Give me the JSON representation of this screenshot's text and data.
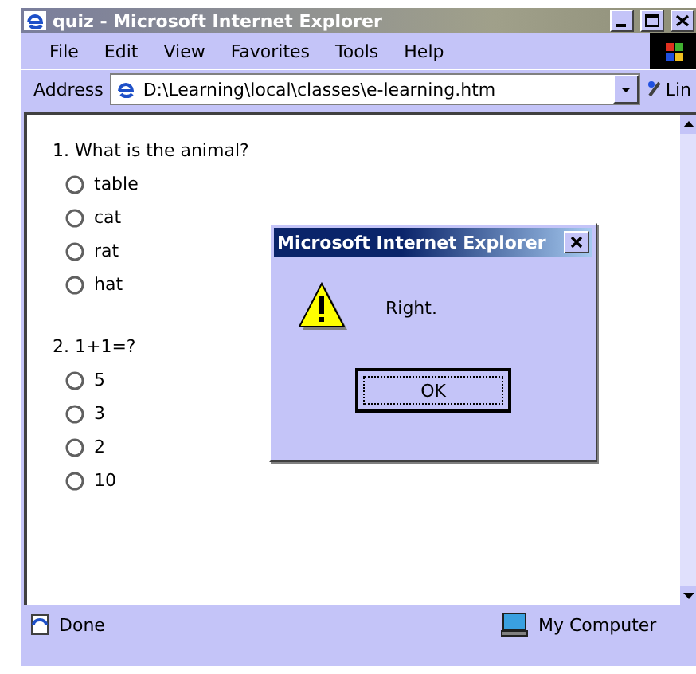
{
  "window": {
    "title": "quiz - Microsoft Internet Explorer"
  },
  "menu": [
    "File",
    "Edit",
    "View",
    "Favorites",
    "Tools",
    "Help"
  ],
  "address_bar": {
    "label": "Address",
    "value": "D:\\Learning\\local\\classes\\e-learning.htm",
    "links_label": "Lin"
  },
  "questions": [
    {
      "text": "1. What is the animal?",
      "options": [
        {
          "label": "table",
          "selected": false
        },
        {
          "label": "cat",
          "selected": false
        },
        {
          "label": "rat",
          "selected": false
        },
        {
          "label": "hat",
          "selected": false
        }
      ]
    },
    {
      "text": "2. 1+1=?",
      "options": [
        {
          "label": "5",
          "selected": false
        },
        {
          "label": "3",
          "selected": false
        },
        {
          "label": "2",
          "selected": false
        },
        {
          "label": "10",
          "selected": false
        }
      ]
    }
  ],
  "dialog": {
    "title": "Microsoft Internet Explorer",
    "message": "Right.",
    "button": "OK"
  },
  "status_bar": {
    "status": "Done",
    "zone": "My Computer"
  }
}
